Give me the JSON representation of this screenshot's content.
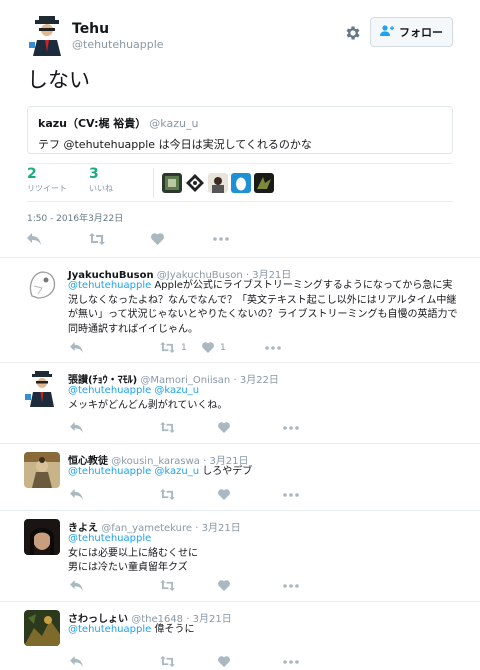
{
  "author": {
    "name": "Tehu",
    "handle": "@tehutehuapple"
  },
  "follow_button": {
    "label": "フォロー",
    "icon": "person-plus-icon"
  },
  "settings_icon": "gear-icon",
  "tweet": {
    "text": "しない",
    "timestamp": "1:50 - 2016年3月22日"
  },
  "quoted": {
    "name": "kazu（CV:梶 裕貴）",
    "handle": "@kazu_u",
    "text": "テフ @tehutehuapple は今日は実況してくれるのかな"
  },
  "stats": {
    "retweets": {
      "count": "2",
      "label": "リツイート"
    },
    "likes": {
      "count": "3",
      "label": "いいね"
    }
  },
  "replies": [
    {
      "name": "JyakuchuBuson",
      "handle": "@JyakuchuBuson",
      "date": "3月21日",
      "mentions": "@tehutehuapple",
      "text_after_mention": " Appleが公式にライブストリーミングするようになってから急に実況しなくなったよね？なんでなんで？「英文テキスト起こし以外にはリアルタイム中継が無い」って状況じゃないとやりたくないの？ライブストリーミングも自慢の英語力で同時通訳すればイイじゃん。",
      "retweets": "1",
      "likes": "1"
    },
    {
      "name": "張讃(ﾁｮｳ・ﾏﾓﾙ)",
      "handle": "@Mamori_Oniisan",
      "date": "3月22日",
      "mentions": "@tehutehuapple @kazu_u",
      "text": "メッキがどんどん剥がれていくね。"
    },
    {
      "name": "恒心教徒",
      "handle": "@kousin_karaswa",
      "date": "3月21日",
      "mentions": "@tehutehuapple @kazu_u",
      "text_after_mention": " しろやデブ"
    },
    {
      "name": "きよえ",
      "handle": "@fan_yametekure",
      "date": "3月21日",
      "mentions": "@tehutehuapple",
      "line1": "女には必要以上に絡むくせに",
      "line2": "男には冷たい童貞留年クズ"
    },
    {
      "name": "さわっしょい",
      "handle": "@the1648",
      "date": "3月21日",
      "mentions": "@tehutehuapple",
      "text_after_mention": " 偉そうに"
    }
  ],
  "date_sep": " · ",
  "colors": {
    "accent": "#1da1f2",
    "stat_green": "#1dab82",
    "muted": "#8899a6",
    "action_gray": "#aab8c2"
  }
}
